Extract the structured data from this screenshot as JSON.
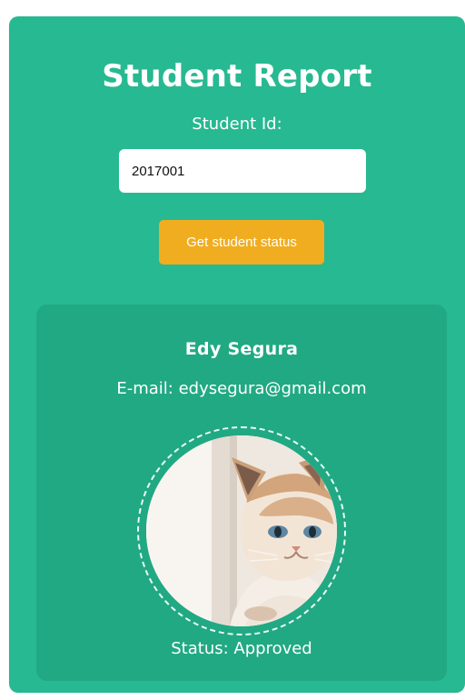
{
  "header": {
    "title": "Student Report",
    "student_id_label": "Student Id:"
  },
  "search": {
    "student_id_value": "2017001"
  },
  "actions": {
    "get_status_label": "Get student status"
  },
  "student": {
    "name": "Edy Segura",
    "email_text": "E-mail: edysegura@gmail.com",
    "status_text": "Status: Approved",
    "avatar_icon": "cat-photo"
  },
  "colors": {
    "panel_bg": "#27b991",
    "card_bg": "#21a983",
    "button_bg": "#f0ad1f",
    "text_light": "#ffffff"
  }
}
